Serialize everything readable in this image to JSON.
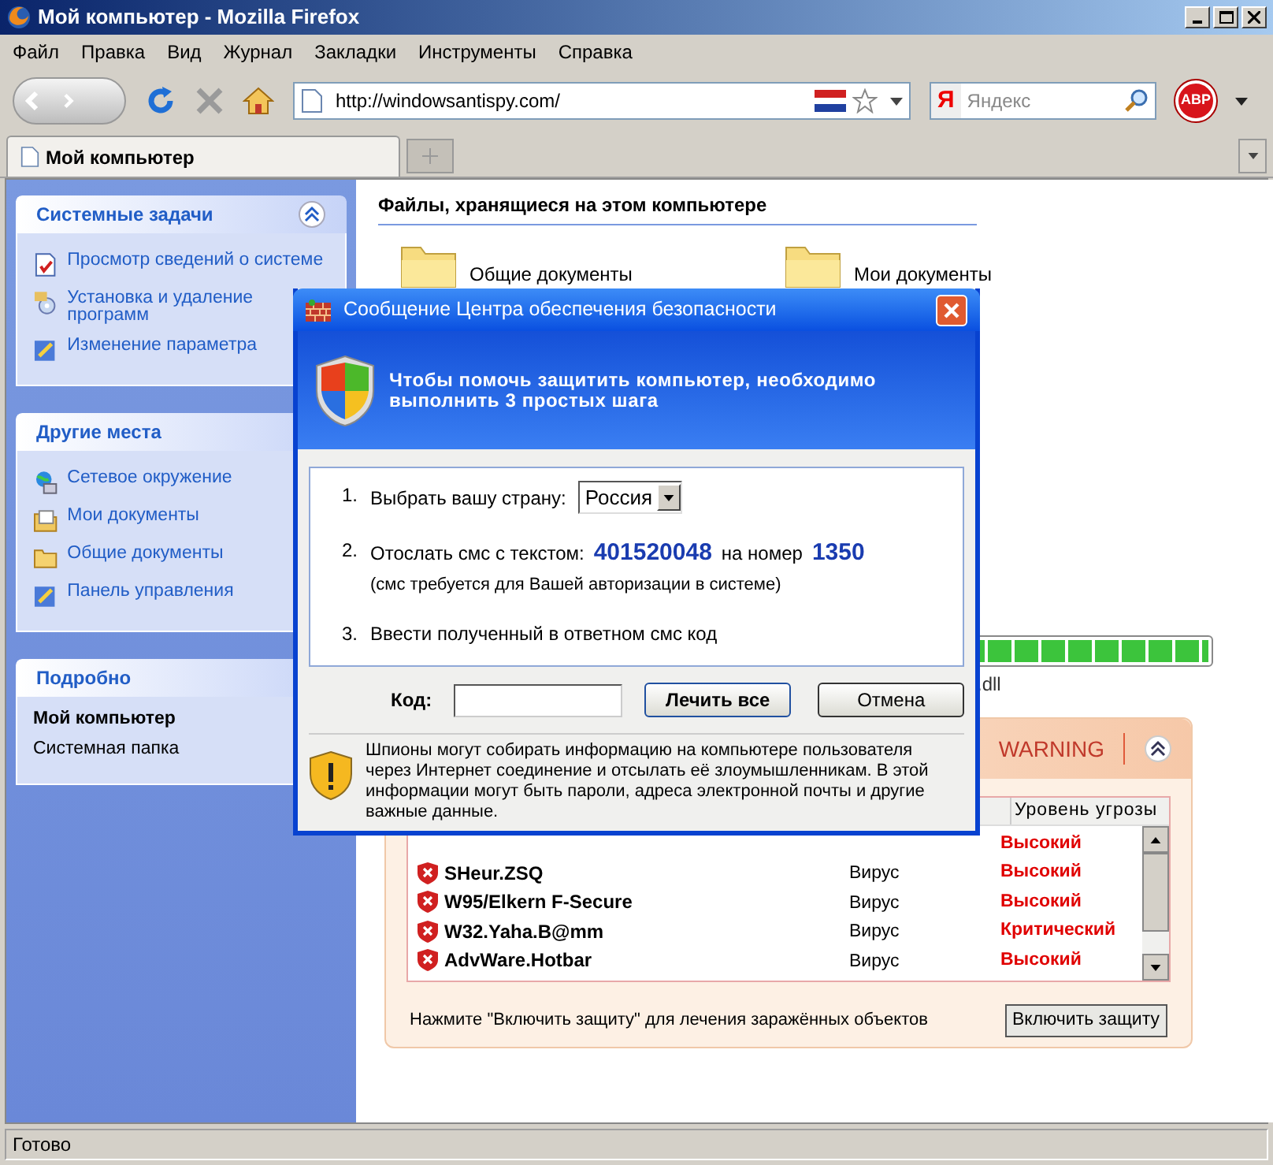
{
  "window": {
    "title": "Мой компьютер - Mozilla Firefox"
  },
  "menu": [
    "Файл",
    "Правка",
    "Вид",
    "Журнал",
    "Закладки",
    "Инструменты",
    "Справка"
  ],
  "toolbar": {
    "url": "http://windowsantispy.com/",
    "search_engine": "Я",
    "search_placeholder": "Яндекс",
    "addon": "ABP"
  },
  "tabs": [
    {
      "label": "Мой компьютер",
      "selected": true
    }
  ],
  "sidebar": {
    "panels": [
      {
        "title": "Системные задачи",
        "collapsible": true,
        "items": [
          {
            "label": "Просмотр сведений о системе",
            "kind": "info"
          },
          {
            "label": "Установка и удаление программ",
            "kind": "programs"
          },
          {
            "label": "Изменение параметра",
            "kind": "settings"
          }
        ]
      },
      {
        "title": "Другие места",
        "items": [
          {
            "label": "Сетевое окружение",
            "kind": "network"
          },
          {
            "label": "Мои документы",
            "kind": "documents"
          },
          {
            "label": "Общие документы",
            "kind": "folder"
          },
          {
            "label": "Панель управления",
            "kind": "settings"
          }
        ]
      },
      {
        "title": "Подробно",
        "details": {
          "name": "Мой компьютер",
          "description": "Системная папка"
        }
      }
    ]
  },
  "content": {
    "heading": "Файлы, хранящиеся на этом компьютере",
    "folders": [
      "Общие документы",
      "Мои документы"
    ],
    "file_label": ".dll",
    "progress": {
      "level": 1
    }
  },
  "warning_panel": {
    "title": "WARNING",
    "columns": [
      "Уровень угрозы"
    ],
    "rows": [
      {
        "level": "Высокий"
      },
      {
        "name": "SHeur.ZSQ",
        "type": "Вирус",
        "level": "Высокий"
      },
      {
        "name": "W95/Elkern F-Secure",
        "type": "Вирус",
        "level": "Высокий"
      },
      {
        "name": "W32.Yaha.B@mm",
        "type": "Вирус",
        "level": "Критический"
      },
      {
        "name": "AdvWare.Hotbar",
        "type": "Вирус",
        "level": "Высокий"
      }
    ],
    "hint": "Нажмите \"Включить защиту\" для лечения заражённых объектов",
    "button": "Включить защиту"
  },
  "dialog": {
    "title": "Сообщение Центра обеспечения безопасности",
    "headline": "Чтобы помочь защитить компьютер, необходимо выполнить 3 простых шага",
    "steps": [
      {
        "kind": "select",
        "number": "1.",
        "text": "Выбрать вашу страну:",
        "value": "Россия"
      },
      {
        "kind": "sms",
        "number": "2.",
        "text": "Отослать смс с текстом:",
        "code": "401520048",
        "middle": "на номер",
        "phone": "1350",
        "note": "(смс требуется для Вашей авторизации в системе)"
      },
      {
        "kind": "plain",
        "number": "3.",
        "text": "Ввести полученный в ответном смс код"
      }
    ],
    "code_label": "Код:",
    "buttons": [
      "Лечить все",
      "Отмена"
    ],
    "warning": "Шпионы могут собирать информацию на компьютере пользователя через Интернет соединение и отсылать её злоумышленникам. В этой информации могут быть пароли, адреса электронной почты и другие важные данные."
  },
  "status_bar": "Готово"
}
